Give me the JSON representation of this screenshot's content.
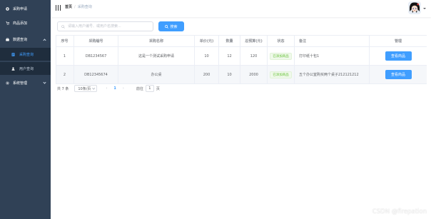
{
  "colors": {
    "sidebar_bg": "#304156",
    "submenu_bg": "#1f2d3d",
    "primary": "#409eff",
    "success": "#67c23a"
  },
  "sidebar": {
    "items": [
      {
        "label": "采购申请",
        "icon": "circle-plus-icon"
      },
      {
        "label": "商品添加",
        "icon": "cart-icon"
      },
      {
        "label": "数据查询",
        "icon": "briefcase-icon",
        "expanded": true
      },
      {
        "label": "系统管理",
        "icon": "gear-icon"
      }
    ],
    "sub_items": [
      {
        "label": "采购查询",
        "icon": "document-icon",
        "active": true
      },
      {
        "label": "用户查询",
        "icon": "user-icon",
        "active": false
      }
    ]
  },
  "header": {
    "breadcrumb": [
      "首页",
      "采购查询"
    ],
    "separator": "/"
  },
  "search": {
    "placeholder": "请输入用户编号、或用户名搜索...",
    "value": "",
    "button_label": "搜索"
  },
  "table": {
    "columns": [
      "序号",
      "采购编号",
      "采购名称",
      "单价(元)",
      "数量",
      "总预算(元)",
      "状态",
      "备注",
      "管理"
    ],
    "rows": [
      {
        "index": "1",
        "code": "DB1234567",
        "name": "这是一个测试采购申请",
        "price": "10",
        "qty": "12",
        "budget": "120",
        "status": "已添加商品",
        "remark": "打印纸十包1",
        "action": "查看商品"
      },
      {
        "index": "2",
        "code": "DB12345674",
        "name": "办公桌",
        "price": "200",
        "qty": "10",
        "budget": "2000",
        "status": "已添加商品",
        "remark": "五个办公室购买两个桌子212121212",
        "action": "查看商品"
      }
    ]
  },
  "pagination": {
    "total": "共 7 条",
    "page_size": "10条/页",
    "current_page": "1",
    "goto_label": "前往",
    "goto_value": "1",
    "page_suffix": "页"
  },
  "watermark": "CSDN @firepation"
}
